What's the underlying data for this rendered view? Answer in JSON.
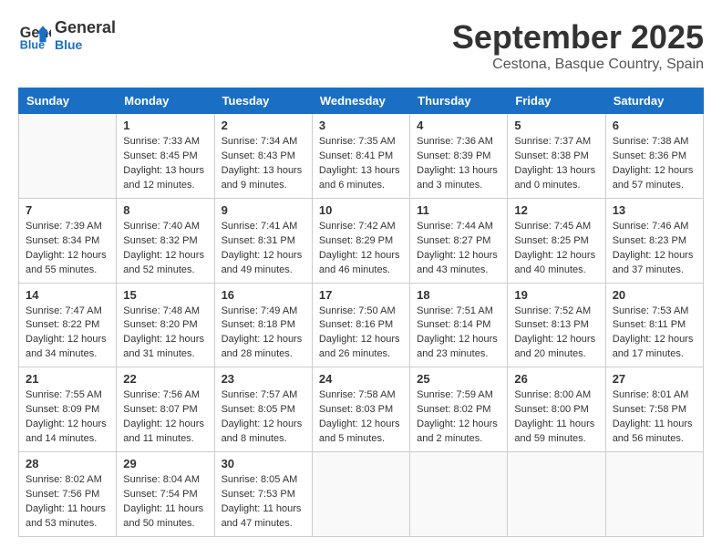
{
  "logo": {
    "line1": "General",
    "line2": "Blue"
  },
  "title": "September 2025",
  "location": "Cestona, Basque Country, Spain",
  "weekdays": [
    "Sunday",
    "Monday",
    "Tuesday",
    "Wednesday",
    "Thursday",
    "Friday",
    "Saturday"
  ],
  "weeks": [
    [
      {
        "day": "",
        "info": ""
      },
      {
        "day": "1",
        "info": "Sunrise: 7:33 AM\nSunset: 8:45 PM\nDaylight: 13 hours\nand 12 minutes."
      },
      {
        "day": "2",
        "info": "Sunrise: 7:34 AM\nSunset: 8:43 PM\nDaylight: 13 hours\nand 9 minutes."
      },
      {
        "day": "3",
        "info": "Sunrise: 7:35 AM\nSunset: 8:41 PM\nDaylight: 13 hours\nand 6 minutes."
      },
      {
        "day": "4",
        "info": "Sunrise: 7:36 AM\nSunset: 8:39 PM\nDaylight: 13 hours\nand 3 minutes."
      },
      {
        "day": "5",
        "info": "Sunrise: 7:37 AM\nSunset: 8:38 PM\nDaylight: 13 hours\nand 0 minutes."
      },
      {
        "day": "6",
        "info": "Sunrise: 7:38 AM\nSunset: 8:36 PM\nDaylight: 12 hours\nand 57 minutes."
      }
    ],
    [
      {
        "day": "7",
        "info": "Sunrise: 7:39 AM\nSunset: 8:34 PM\nDaylight: 12 hours\nand 55 minutes."
      },
      {
        "day": "8",
        "info": "Sunrise: 7:40 AM\nSunset: 8:32 PM\nDaylight: 12 hours\nand 52 minutes."
      },
      {
        "day": "9",
        "info": "Sunrise: 7:41 AM\nSunset: 8:31 PM\nDaylight: 12 hours\nand 49 minutes."
      },
      {
        "day": "10",
        "info": "Sunrise: 7:42 AM\nSunset: 8:29 PM\nDaylight: 12 hours\nand 46 minutes."
      },
      {
        "day": "11",
        "info": "Sunrise: 7:44 AM\nSunset: 8:27 PM\nDaylight: 12 hours\nand 43 minutes."
      },
      {
        "day": "12",
        "info": "Sunrise: 7:45 AM\nSunset: 8:25 PM\nDaylight: 12 hours\nand 40 minutes."
      },
      {
        "day": "13",
        "info": "Sunrise: 7:46 AM\nSunset: 8:23 PM\nDaylight: 12 hours\nand 37 minutes."
      }
    ],
    [
      {
        "day": "14",
        "info": "Sunrise: 7:47 AM\nSunset: 8:22 PM\nDaylight: 12 hours\nand 34 minutes."
      },
      {
        "day": "15",
        "info": "Sunrise: 7:48 AM\nSunset: 8:20 PM\nDaylight: 12 hours\nand 31 minutes."
      },
      {
        "day": "16",
        "info": "Sunrise: 7:49 AM\nSunset: 8:18 PM\nDaylight: 12 hours\nand 28 minutes."
      },
      {
        "day": "17",
        "info": "Sunrise: 7:50 AM\nSunset: 8:16 PM\nDaylight: 12 hours\nand 26 minutes."
      },
      {
        "day": "18",
        "info": "Sunrise: 7:51 AM\nSunset: 8:14 PM\nDaylight: 12 hours\nand 23 minutes."
      },
      {
        "day": "19",
        "info": "Sunrise: 7:52 AM\nSunset: 8:13 PM\nDaylight: 12 hours\nand 20 minutes."
      },
      {
        "day": "20",
        "info": "Sunrise: 7:53 AM\nSunset: 8:11 PM\nDaylight: 12 hours\nand 17 minutes."
      }
    ],
    [
      {
        "day": "21",
        "info": "Sunrise: 7:55 AM\nSunset: 8:09 PM\nDaylight: 12 hours\nand 14 minutes."
      },
      {
        "day": "22",
        "info": "Sunrise: 7:56 AM\nSunset: 8:07 PM\nDaylight: 12 hours\nand 11 minutes."
      },
      {
        "day": "23",
        "info": "Sunrise: 7:57 AM\nSunset: 8:05 PM\nDaylight: 12 hours\nand 8 minutes."
      },
      {
        "day": "24",
        "info": "Sunrise: 7:58 AM\nSunset: 8:03 PM\nDaylight: 12 hours\nand 5 minutes."
      },
      {
        "day": "25",
        "info": "Sunrise: 7:59 AM\nSunset: 8:02 PM\nDaylight: 12 hours\nand 2 minutes."
      },
      {
        "day": "26",
        "info": "Sunrise: 8:00 AM\nSunset: 8:00 PM\nDaylight: 11 hours\nand 59 minutes."
      },
      {
        "day": "27",
        "info": "Sunrise: 8:01 AM\nSunset: 7:58 PM\nDaylight: 11 hours\nand 56 minutes."
      }
    ],
    [
      {
        "day": "28",
        "info": "Sunrise: 8:02 AM\nSunset: 7:56 PM\nDaylight: 11 hours\nand 53 minutes."
      },
      {
        "day": "29",
        "info": "Sunrise: 8:04 AM\nSunset: 7:54 PM\nDaylight: 11 hours\nand 50 minutes."
      },
      {
        "day": "30",
        "info": "Sunrise: 8:05 AM\nSunset: 7:53 PM\nDaylight: 11 hours\nand 47 minutes."
      },
      {
        "day": "",
        "info": ""
      },
      {
        "day": "",
        "info": ""
      },
      {
        "day": "",
        "info": ""
      },
      {
        "day": "",
        "info": ""
      }
    ]
  ]
}
